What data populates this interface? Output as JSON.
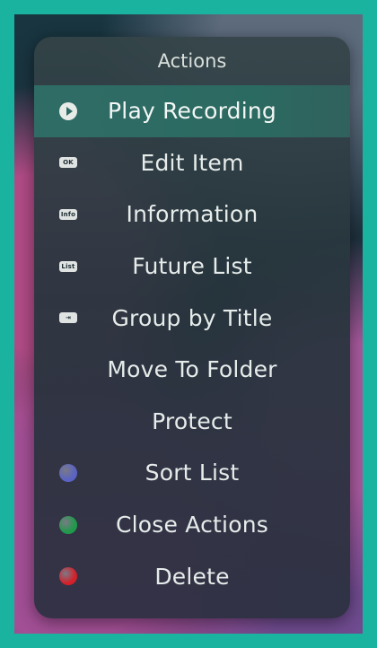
{
  "menu": {
    "title": "Actions",
    "items": [
      {
        "label": "Play Recording",
        "key": "play",
        "key_icon": "play-button-icon",
        "selected": true
      },
      {
        "label": "Edit Item",
        "key": "OK",
        "key_icon": "ok-button-icon"
      },
      {
        "label": "Information",
        "key": "Info",
        "key_icon": "info-button-icon"
      },
      {
        "label": "Future List",
        "key": "List",
        "key_icon": "list-button-icon"
      },
      {
        "label": "Group by Title",
        "key": "⇥",
        "key_icon": "skip-button-icon"
      },
      {
        "label": "Move To Folder"
      },
      {
        "label": "Protect"
      },
      {
        "label": "Sort List",
        "key_icon": "blue-button-icon",
        "key_color": "#5a63c4"
      },
      {
        "label": "Close Actions",
        "key_icon": "green-button-icon",
        "key_color": "#1f9a4a"
      },
      {
        "label": "Delete",
        "key_icon": "red-button-icon",
        "key_color": "#d3202a"
      }
    ]
  },
  "colors": {
    "accent_border": "#1ab3a0",
    "selected_row": "#2f6c66"
  }
}
